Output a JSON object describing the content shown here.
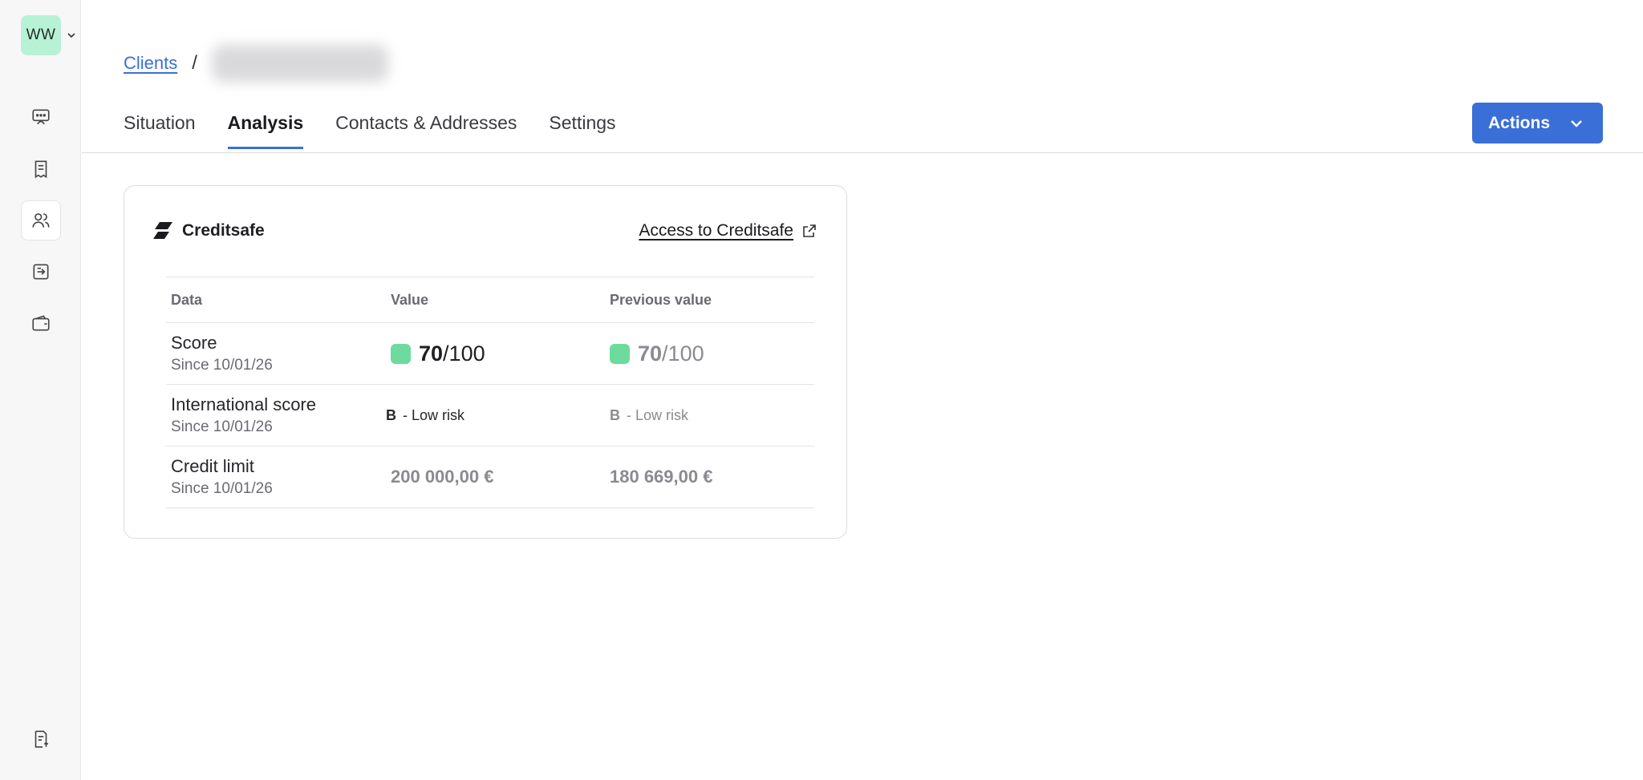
{
  "workspace": {
    "initials": "WW"
  },
  "sidebar": {
    "items": [
      {
        "name": "presentation-icon"
      },
      {
        "name": "receipt-icon"
      },
      {
        "name": "users-icon",
        "active": true
      },
      {
        "name": "transfer-icon"
      },
      {
        "name": "wallet-icon"
      }
    ],
    "bottom_icon": "document-upload-icon"
  },
  "breadcrumb": {
    "parent": "Clients",
    "separator": "/"
  },
  "tabs": [
    {
      "label": "Situation"
    },
    {
      "label": "Analysis",
      "active": true
    },
    {
      "label": "Contacts & Addresses"
    },
    {
      "label": "Settings"
    }
  ],
  "actions": {
    "label": "Actions"
  },
  "creditsafe": {
    "title": "Creditsafe",
    "link_label": "Access to Creditsafe",
    "columns": [
      "Data",
      "Value",
      "Previous value"
    ],
    "rows": [
      {
        "label": "Score",
        "since": "Since 10/01/26",
        "value_num": "70",
        "value_den": "/100",
        "prev_num": "70",
        "prev_den": "/100"
      },
      {
        "label": "International score",
        "since": "Since 10/01/26",
        "value_grade": "B",
        "value_text": "- Low risk",
        "prev_grade": "B",
        "prev_text": "- Low risk"
      },
      {
        "label": "Credit limit",
        "since": "Since 10/01/26",
        "value": "200 000,00 €",
        "prev": "180 669,00 €"
      }
    ]
  },
  "colors": {
    "accent": "#3a6fd8",
    "score_good": "#6ddb9d",
    "workspace_bg": "#b8f2d6"
  }
}
